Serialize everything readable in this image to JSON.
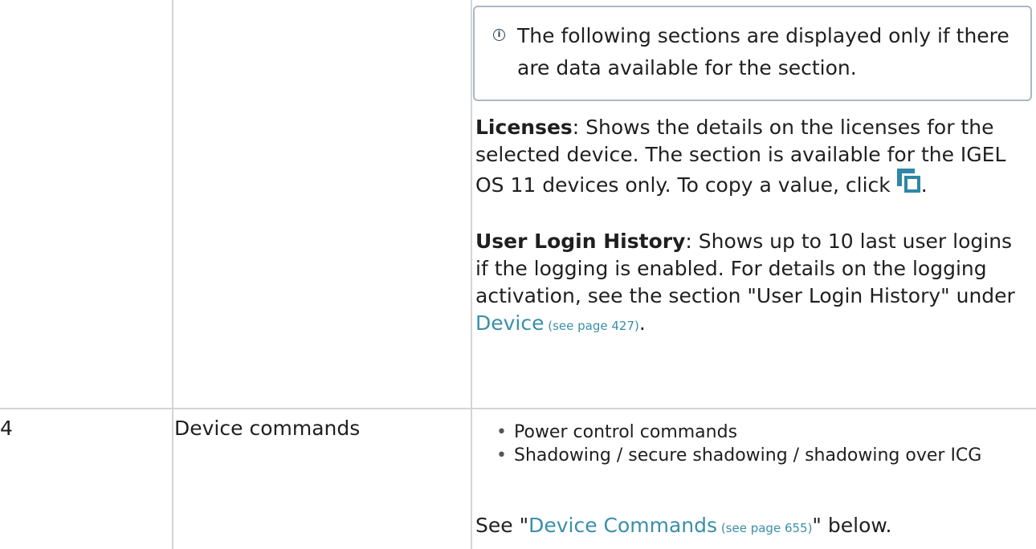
{
  "info_box": {
    "icon": "info-icon",
    "text": "The following sections are displayed only if there are data available for the section."
  },
  "licenses": {
    "label": "Licenses",
    "text": ": Shows the details on the licenses for the selected device. The section is available for the IGEL OS 11 devices only. To copy a value, click ",
    "icon": "copy-icon",
    "end": "."
  },
  "login_history": {
    "label": "User Login History",
    "text": ":  Shows up to 10 last user logins if the logging is enabled. For details on the logging activation, see the section \"User Login History\" under ",
    "link_text": "Device",
    "link_ref": " (see page 427)",
    "end": "."
  },
  "row4": {
    "number": "4",
    "name": "Device commands",
    "bullets": [
      "Power control commands",
      "Shadowing / secure shadowing / shadowing over ICG"
    ],
    "see_prefix": "See \"",
    "see_link": "Device Commands",
    "see_ref": " (see page 655)",
    "see_suffix": "\" below."
  },
  "colors": {
    "link": "#3a8fa8",
    "info_border": "#a9b7c7",
    "grid": "#d4d4d4"
  }
}
